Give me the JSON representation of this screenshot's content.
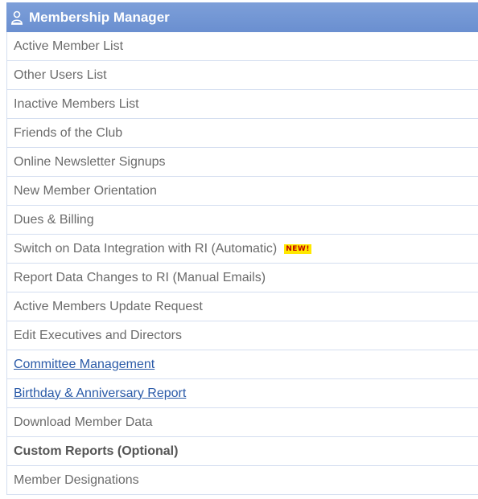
{
  "header": {
    "title": "Membership Manager",
    "icon": "member-icon"
  },
  "menu": {
    "items": [
      {
        "label": "Active Member List",
        "style": "plain"
      },
      {
        "label": "Other Users List",
        "style": "plain"
      },
      {
        "label": "Inactive Members List",
        "style": "plain"
      },
      {
        "label": "Friends of the Club",
        "style": "plain"
      },
      {
        "label": "Online Newsletter Signups",
        "style": "plain"
      },
      {
        "label": "New Member Orientation",
        "style": "plain"
      },
      {
        "label": "Dues & Billing",
        "style": "plain"
      },
      {
        "label": "Switch on Data Integration with RI (Automatic)",
        "style": "plain",
        "badge": "NEW!"
      },
      {
        "label": "Report Data Changes to RI (Manual Emails)",
        "style": "plain"
      },
      {
        "label": "Active Members Update Request",
        "style": "plain"
      },
      {
        "label": "Edit Executives and Directors",
        "style": "plain"
      },
      {
        "label": "Committee Management",
        "style": "link"
      },
      {
        "label": "Birthday & Anniversary Report",
        "style": "link"
      },
      {
        "label": "Download Member Data",
        "style": "plain"
      },
      {
        "label": "Custom Reports (Optional)",
        "style": "bold"
      },
      {
        "label": "Member Designations",
        "style": "plain"
      }
    ]
  },
  "colors": {
    "header_bg": "#7096d4",
    "text": "#6b6b6b",
    "link": "#2a5aa8",
    "badge_bg": "#ffe800",
    "badge_text": "#c00000"
  }
}
